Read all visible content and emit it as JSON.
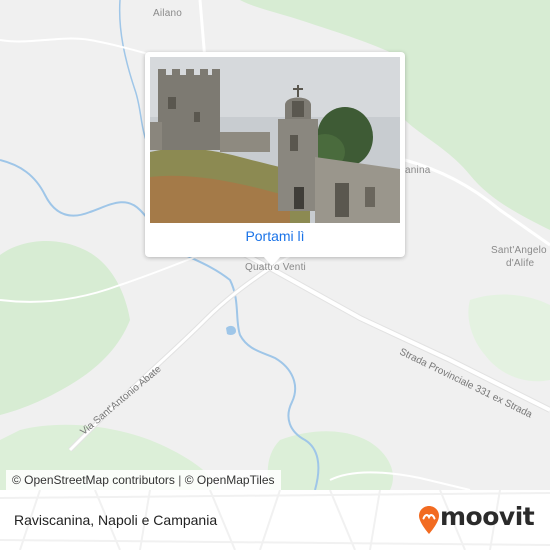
{
  "map": {
    "labels": {
      "ailano": "Ailano",
      "quattro_venti": "Quattro Venti",
      "sant_angelo_line1": "Sant'Angelo",
      "sant_angelo_line2": "d'Alife",
      "canina_fragment": "anina"
    },
    "road_labels": {
      "strada_provinciale": "Strada Provinciale 331 ex Strada",
      "via_sant_antonio": "Via Sant'Antonio Abate"
    },
    "colors": {
      "land": "#f0f0f0",
      "forest": "#d7ecd3",
      "water": "#9fc6e8",
      "road": "#ffffff",
      "road_outline": "#e2e2e2"
    }
  },
  "popup": {
    "photo_icon": "castle-ruins-photo",
    "cta_label": "Portami lì"
  },
  "attribution": {
    "osm": "© OpenStreetMap contributors",
    "separator": "|",
    "omt": "© OpenMapTiles"
  },
  "footer": {
    "place_name": "Raviscanina, Napoli e Campania",
    "brand": "moovit",
    "brand_color": "#f26b21"
  }
}
